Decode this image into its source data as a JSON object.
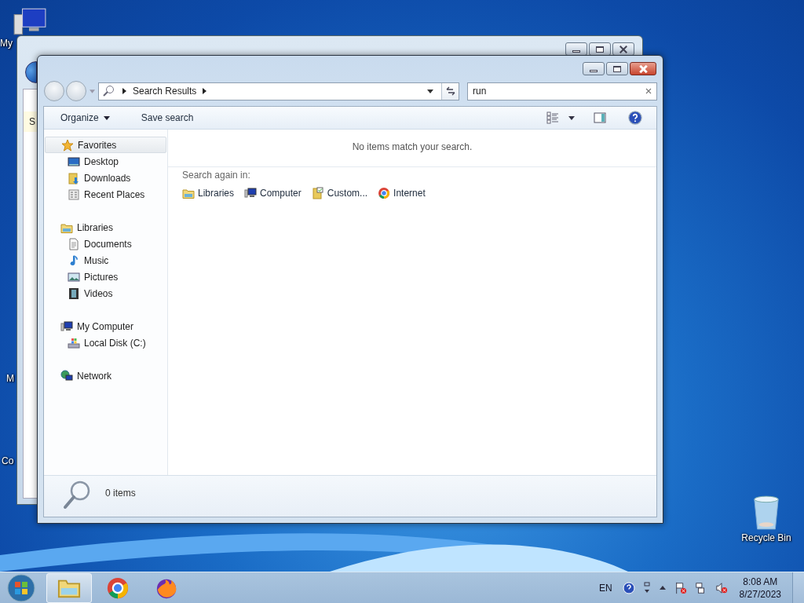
{
  "desktop": {
    "icons": [
      {
        "label": "My",
        "kind": "computer"
      },
      {
        "label": "M",
        "kind": "none"
      },
      {
        "label": "Co",
        "kind": "none"
      },
      {
        "label": "Recycle Bin",
        "kind": "bin"
      }
    ]
  },
  "background_window": {
    "field_text": "S"
  },
  "window": {
    "address": {
      "crumbs": [
        "Search Results"
      ]
    },
    "search": {
      "value": "run"
    },
    "toolbar": {
      "buttons": [
        {
          "label": "Organize",
          "dropdown": true
        },
        {
          "label": "Save search",
          "dropdown": false
        }
      ]
    },
    "nav": [
      {
        "label": "Favorites",
        "kind": "star",
        "selected": true,
        "children": [
          {
            "label": "Desktop",
            "kind": "desktop",
            "selected": false
          },
          {
            "label": "Downloads",
            "kind": "downloads",
            "selected": false
          },
          {
            "label": "Recent Places",
            "kind": "recent",
            "selected": false
          }
        ]
      },
      {
        "label": "Libraries",
        "kind": "libraries",
        "selected": false,
        "children": [
          {
            "label": "Documents",
            "kind": "documents",
            "selected": false
          },
          {
            "label": "Music",
            "kind": "music",
            "selected": false
          },
          {
            "label": "Pictures",
            "kind": "pictures",
            "selected": false
          },
          {
            "label": "Videos",
            "kind": "videos",
            "selected": false
          }
        ]
      },
      {
        "label": "My Computer",
        "kind": "computer",
        "selected": false,
        "children": [
          {
            "label": "Local Disk (C:)",
            "kind": "disk",
            "selected": false
          }
        ]
      },
      {
        "label": "Network",
        "kind": "network",
        "selected": false
      }
    ],
    "message": "No items match your search.",
    "search_again": {
      "label": "Search again in:",
      "locations": [
        {
          "label": "Libraries",
          "kind": "libraries"
        },
        {
          "label": "Computer",
          "kind": "computer"
        },
        {
          "label": "Custom...",
          "kind": "custom"
        },
        {
          "label": "Internet",
          "kind": "chrome"
        }
      ]
    },
    "details": {
      "count": "0 items"
    }
  },
  "taskbar": {
    "pinned": [
      {
        "kind": "explorer",
        "selected": true
      },
      {
        "kind": "chrome",
        "selected": false
      },
      {
        "kind": "firefox",
        "selected": false
      }
    ],
    "language": "EN",
    "time": "8:08 AM",
    "date": "8/27/2023"
  }
}
